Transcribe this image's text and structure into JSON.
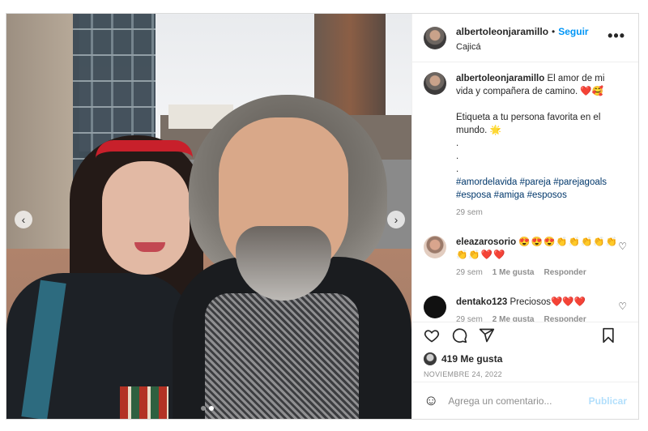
{
  "post": {
    "username": "albertoleonjaramillo",
    "follow_label": "Seguir",
    "location": "Cajicá",
    "separator": "•",
    "more_label": "•••",
    "caption_user": "albertoleonjaramillo",
    "caption_text": "El amor de mi vida y compañera de camino. ❤️🥰\n\nEtiqueta a tu persona favorita en el mundo. 🌟\n.\n.\n.",
    "caption_tags": "#amordelavida #pareja #parejagoals #esposa #amiga #esposos",
    "caption_time": "29 sem"
  },
  "comments": [
    {
      "user": "eleazarosorio",
      "text": "😍😍😍👏👏👏👏👏👏👏❤️❤️",
      "time": "29 sem",
      "likes": "1 Me gusta",
      "reply": "Responder"
    },
    {
      "user": "dentako123",
      "text": "Preciosos❤️❤️❤️",
      "time": "29 sem",
      "likes": "2 Me gusta",
      "reply": "Responder"
    }
  ],
  "actions": {
    "like_icon": "heart-icon",
    "comment_icon": "comment-icon",
    "share_icon": "share-icon",
    "save_icon": "bookmark-icon",
    "likes_count": "419 Me gusta",
    "date": "NOVIEMBRE 24, 2022"
  },
  "add_comment": {
    "placeholder": "Agrega un comentario...",
    "publish_label": "Publicar"
  },
  "carousel": {
    "prev": "‹",
    "next": "›",
    "total": 2,
    "current": 2
  },
  "colors": {
    "accent": "#0095f6",
    "link": "#00376b",
    "muted": "#8e8e8e",
    "publish_disabled": "#b2dffc"
  }
}
